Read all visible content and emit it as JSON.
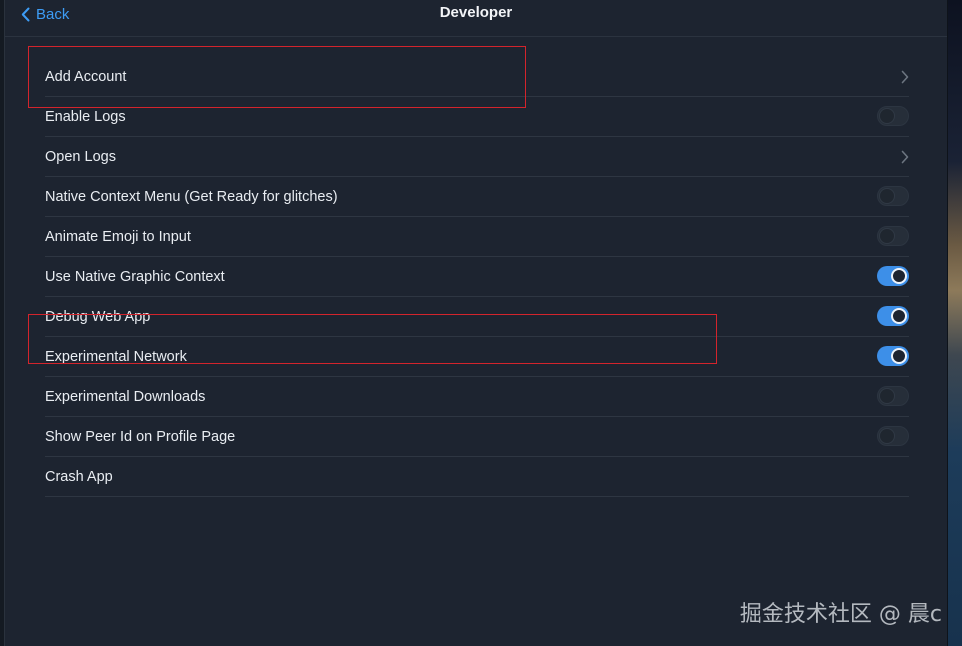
{
  "header": {
    "back_label": "Back",
    "title": "Developer"
  },
  "rows": [
    {
      "label": "Add Account",
      "control": "chevron"
    },
    {
      "label": "Enable Logs",
      "control": "toggle",
      "on": false
    },
    {
      "label": "Open Logs",
      "control": "chevron"
    },
    {
      "label": "Native Context Menu (Get Ready for glitches)",
      "control": "toggle",
      "on": false
    },
    {
      "label": "Animate Emoji to Input",
      "control": "toggle",
      "on": false
    },
    {
      "label": "Use Native Graphic Context",
      "control": "toggle",
      "on": true
    },
    {
      "label": "Debug Web App",
      "control": "toggle",
      "on": true
    },
    {
      "label": "Experimental Network",
      "control": "toggle",
      "on": true
    },
    {
      "label": "Experimental Downloads",
      "control": "toggle",
      "on": false
    },
    {
      "label": "Show Peer Id on Profile Page",
      "control": "toggle",
      "on": false
    },
    {
      "label": "Crash App",
      "control": "none"
    }
  ],
  "watermark": "掘金技术社区 @ 晨c",
  "colors": {
    "accent": "#3d9cf5",
    "toggle_on": "#3d8fe8",
    "background": "#1d2430",
    "highlight_box": "#d3242c"
  },
  "icons": {
    "back": "chevron-left-icon",
    "disclosure": "chevron-right-icon"
  }
}
